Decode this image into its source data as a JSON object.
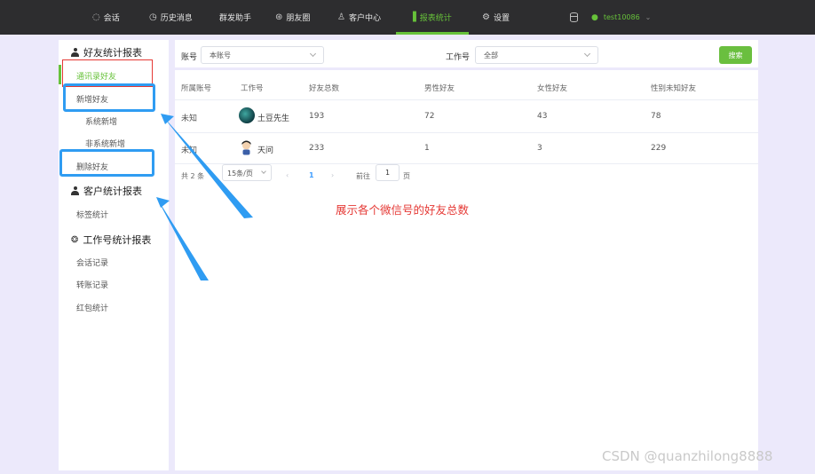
{
  "topnav": {
    "items": [
      {
        "label": "会话",
        "icon": "chat-icon"
      },
      {
        "label": "历史消息",
        "icon": "clock-icon"
      },
      {
        "label": "群发助手",
        "icon": ""
      },
      {
        "label": "朋友圈",
        "icon": "aperture-icon"
      },
      {
        "label": "客户中心",
        "icon": "user-icon"
      },
      {
        "label": "报表统计",
        "icon": "bar-chart-icon"
      },
      {
        "label": "设置",
        "icon": "gear-icon"
      }
    ],
    "active": "报表统计",
    "user": "test10086",
    "accent": "#67c23a"
  },
  "sidebar": {
    "groups": [
      {
        "title": "好友统计报表",
        "icon": "user-icon"
      },
      {
        "title": "客户统计报表",
        "icon": "user-icon"
      },
      {
        "title": "工作号统计报表",
        "icon": "wechat-icon"
      }
    ],
    "items": [
      "通讯录好友",
      "新增好友",
      "系统新增",
      "非系统新增",
      "删除好友",
      "标签统计",
      "会话记录",
      "转账记录",
      "红包统计"
    ],
    "active_item": "通讯录好友"
  },
  "filters": {
    "account_label": "账号",
    "account_value": "本账号",
    "worker_label": "工作号",
    "worker_value": "全部",
    "search_label": "搜索"
  },
  "table": {
    "columns": [
      "所属账号",
      "工作号",
      "好友总数",
      "男性好友",
      "女性好友",
      "性别未知好友"
    ],
    "rows": [
      {
        "owner": "未知",
        "worker": "土豆先生",
        "total": "193",
        "male": "72",
        "female": "43",
        "unknown": "78"
      },
      {
        "owner": "未知",
        "worker": "天问",
        "total": "233",
        "male": "1",
        "female": "3",
        "unknown": "229"
      }
    ]
  },
  "pagination": {
    "total": "共 2 条",
    "page_size": "15条/页",
    "current": "1",
    "goto_label": "前往",
    "goto_value": "1",
    "page_unit": "页"
  },
  "annotation": "展示各个微信号的好友总数",
  "watermark": "CSDN @quanzhilong8888"
}
